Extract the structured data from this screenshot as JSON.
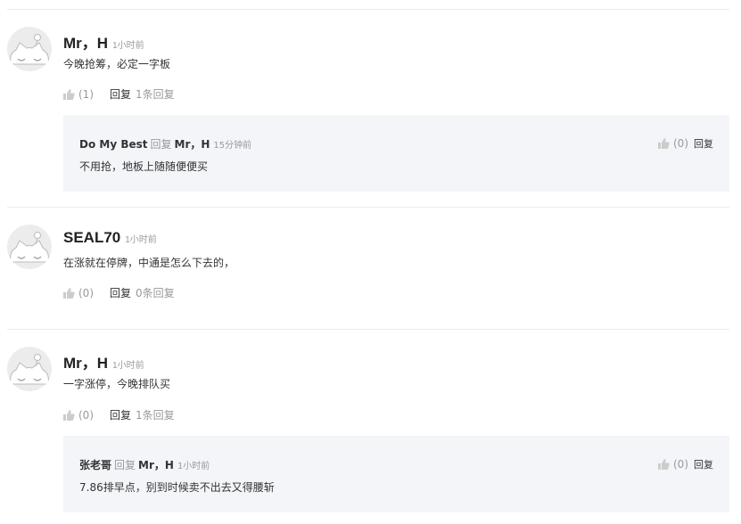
{
  "comments": [
    {
      "author": "Mr，H",
      "time": "1小时前",
      "text": "今晚抢筹，必定一字板",
      "likes": "(1)",
      "reply_label": "回复",
      "reply_count": "1条回复",
      "replies": [
        {
          "author": "Do My Best",
          "reply_word": "回复",
          "target": "Mr，H",
          "time": "15分钟前",
          "text": "不用抢，地板上随随便便买",
          "likes": "(0)",
          "reply_label": "回复"
        }
      ]
    },
    {
      "author": "SEAL70",
      "time": "1小时前",
      "text": "在涨就在停牌，中通是怎么下去的，",
      "likes": "(0)",
      "reply_label": "回复",
      "reply_count": "0条回复",
      "replies": []
    },
    {
      "author": "Mr，H",
      "time": "1小时前",
      "text": "一字涨停，今晚排队买",
      "likes": "(0)",
      "reply_label": "回复",
      "reply_count": "1条回复",
      "replies": [
        {
          "author": "张老哥",
          "reply_word": "回复",
          "target": "Mr，H",
          "time": "1小时前",
          "text": "7.86排早点，别到时候卖不出去又得腰斩",
          "likes": "(0)",
          "reply_label": "回复"
        }
      ]
    }
  ],
  "colors": {
    "reply_bg": "#f4f5f9",
    "muted": "#999999",
    "text": "#333333"
  },
  "icons": {
    "like": "thumbs-up-icon",
    "avatar": "default-avatar-icon"
  }
}
